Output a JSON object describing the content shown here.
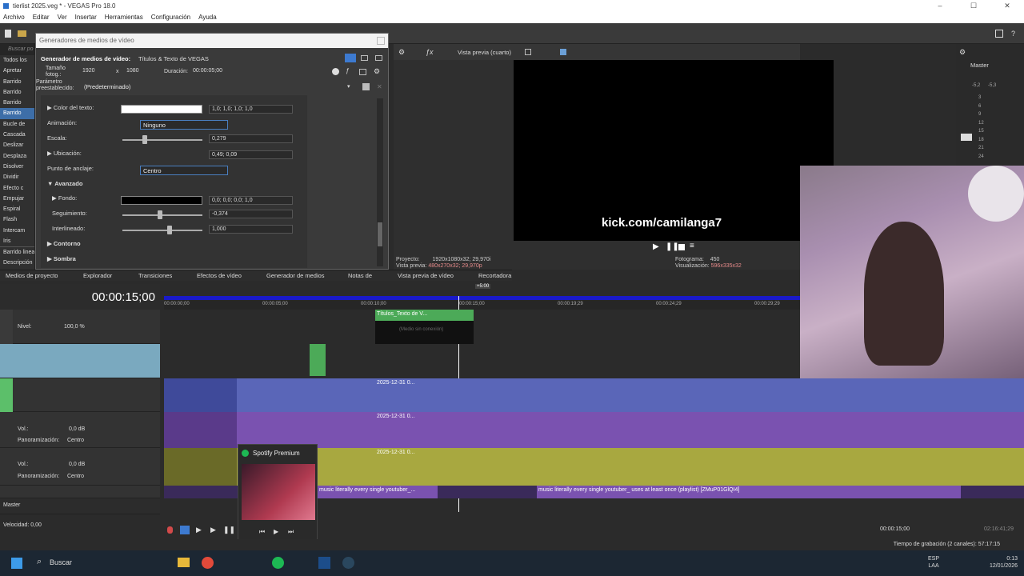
{
  "window": {
    "title": "tierlist 2025.veg * - VEGAS Pro 18.0",
    "controls": [
      "–",
      "☐",
      "✕"
    ]
  },
  "menu": [
    "Archivo",
    "Editar",
    "Ver",
    "Insertar",
    "Herramientas",
    "Configuración",
    "Ayuda"
  ],
  "left_pane": {
    "search_placeholder": "Buscar po",
    "items": [
      "Todos los",
      "Apretar",
      "Barrido",
      "Barrido",
      "Barrido",
      "Barrido",
      "Bucle de",
      "Cascada",
      "Deslizar",
      "Desplaza",
      "Disolver",
      "Dividir",
      "Efecto c",
      "Empujar",
      "Espiral",
      "Flash",
      "Intercam",
      "Iris",
      "Barrido lineal",
      "Descripción"
    ],
    "selected_index": 5
  },
  "media_generator": {
    "window_title": "Generadores de medios de vídeo",
    "header_label": "Generador de medios de vídeo:",
    "header_value": "Títulos & Texto de VEGAS",
    "frame_size_label": "Tamaño fotog.:",
    "frame_w": "1920",
    "frame_x": "x",
    "frame_h": "1080",
    "duration_label": "Duración:",
    "duration_value": "00:00:05;00",
    "preset_label": "Parámetro preestablecido:",
    "preset_value": "(Predeterminado)",
    "props": {
      "color_label": "Color del texto:",
      "color_value": "1,0; 1,0; 1,0; 1,0",
      "animation_label": "Animación:",
      "animation_value": "Ninguno",
      "scale_label": "Escala:",
      "scale_value": "0,279",
      "location_label": "Ubicación:",
      "location_value": "0,49; 0,09",
      "anchor_label": "Punto de anclaje:",
      "anchor_value": "Centro",
      "advanced_label": "Avanzado",
      "background_label": "Fondo:",
      "background_value": "0,0; 0,0; 0,0; 1,0",
      "tracking_label": "Seguimiento:",
      "tracking_value": "-0,374",
      "linespacing_label": "Interlineado:",
      "linespacing_value": "1,000",
      "outline_label": "Contorno",
      "shadow_label": "Sombra"
    },
    "scale_fraction": 0.279
  },
  "tabs": [
    "Medios de proyecto",
    "Explorador",
    "Transiciones",
    "Efectos de vídeo",
    "Generador de medios",
    "Notas de",
    "Vista previa de vídeo",
    "Recortadora"
  ],
  "preview": {
    "mode": "Vista previa (cuarto)",
    "overlay_text": "kick.com/camilanga7",
    "project_label": "Proyecto:",
    "project_value": "1920x1080x32; 29,970i",
    "preview_label": "Vista previa:",
    "preview_value": "480x270x32; 29,970p",
    "frame_label": "Fotograma:",
    "frame_value": "450",
    "display_label": "Visualización:",
    "display_value": "596x335x32"
  },
  "master": {
    "label": "Master",
    "peaks": [
      "-5,2",
      "-5,3"
    ],
    "scale": [
      "3",
      "6",
      "9",
      "12",
      "15",
      "18",
      "21",
      "24"
    ]
  },
  "timeline": {
    "timecode": "00:00:15;00",
    "ruler_marks": [
      "00:00:00;00",
      "00:00:05;00",
      "00:00:10;00",
      "00:00:15;00",
      "00:00:19;29",
      "00:00:24;29",
      "00:00:29;29"
    ],
    "playhead_label": "+5:00",
    "level_label": "Nivel:",
    "level_value": "100,0 %",
    "vol_label": "Vol.:",
    "vol_value": "0,0 dB",
    "pan_label": "Panoramización:",
    "pan_value": "Centro",
    "master_label": "Master",
    "speed_label": "Velocidad: 0,00",
    "title_clip": "Títulos_Texto de V...",
    "title_clip_sub": "(Medio sin conexión)",
    "clip_label": "2025-12-31 0...",
    "audio_clip_a": "music literally every single youtuber_...",
    "audio_clip_b": "music literally every single youtuber_ uses at least once (playlist) [ZMuP01GlQI4]",
    "end_timecode": "00:00:15;00",
    "record_time": "Tiempo de grabación (2 canales): 57:17:15",
    "total_time": "02:16:41;29"
  },
  "spotify": {
    "title": "Spotify Premium"
  },
  "taskbar": {
    "search": "Buscar",
    "lang": "ESP",
    "lang2": "LAA",
    "time": "0:13",
    "date": "12/01/2026"
  }
}
